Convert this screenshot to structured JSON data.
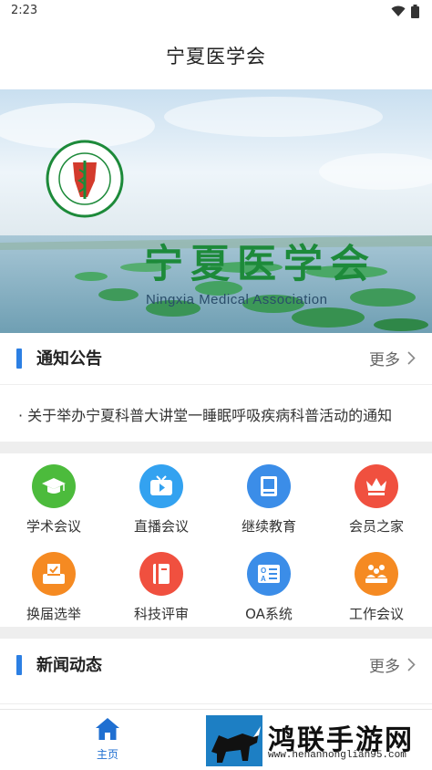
{
  "status": {
    "time": "2:23"
  },
  "header": {
    "title": "宁夏医学会"
  },
  "banner": {
    "title_cn": "宁夏医学会",
    "title_en": "Ningxia Medical Association"
  },
  "notice": {
    "title": "通知公告",
    "more": "更多",
    "items": [
      "· 关于举办宁夏科普大讲堂一睡眠呼吸疾病科普活动的通知"
    ]
  },
  "grid": {
    "items": [
      {
        "label": "学术会议",
        "icon": "graduation-cap-icon",
        "color": "#4cbb3c"
      },
      {
        "label": "直播会议",
        "icon": "tv-play-icon",
        "color": "#33a2f0"
      },
      {
        "label": "继续教育",
        "icon": "book-icon",
        "color": "#3b8de8"
      },
      {
        "label": "会员之家",
        "icon": "crown-icon",
        "color": "#f0503f"
      },
      {
        "label": "换届选举",
        "icon": "ballot-box-icon",
        "color": "#f58a22"
      },
      {
        "label": "科技评审",
        "icon": "notebook-icon",
        "color": "#f0503f"
      },
      {
        "label": "OA系统",
        "icon": "oa-card-icon",
        "color": "#3b8de8"
      },
      {
        "label": "工作会议",
        "icon": "people-meeting-icon",
        "color": "#f58a22"
      }
    ]
  },
  "news": {
    "title": "新闻动态",
    "more": "更多"
  },
  "tabbar": {
    "home_label": "主页",
    "active_color": "#1f6fd1"
  },
  "watermark": {
    "text": "鸿联手游网",
    "url": "www.henanhonglian95.com"
  }
}
